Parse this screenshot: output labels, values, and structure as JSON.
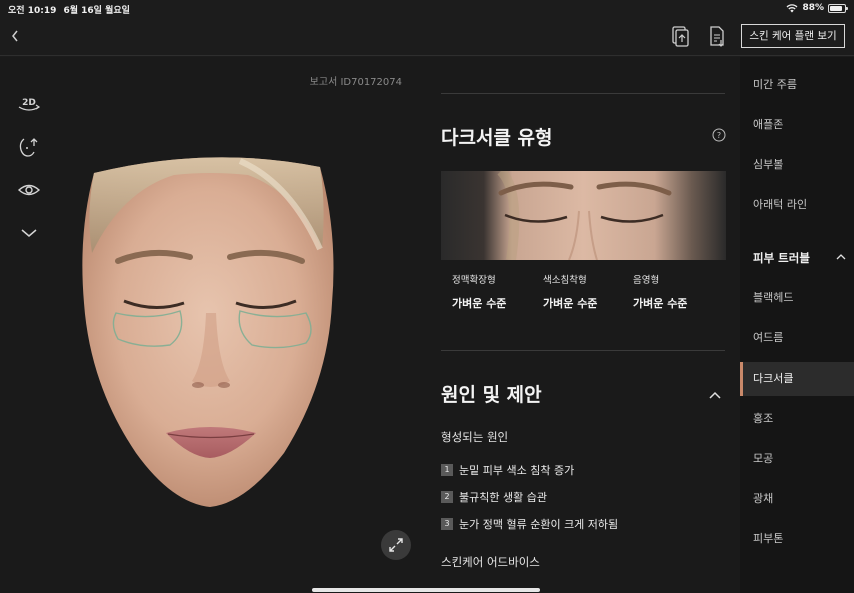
{
  "status_bar": {
    "time": "오전 10:19",
    "date": "6월 16일 월요일",
    "battery": "88%",
    "battery_level": 0.88,
    "wifi_icon": "wifi-icon",
    "battery_icon": "battery-icon"
  },
  "nav": {
    "back_icon": "chevron-left-icon",
    "share_icon": "document-share-icon",
    "export_icon": "document-export-icon",
    "plan_button": "스킨 케어 플랜 보기"
  },
  "left_panel": {
    "report_id": "보고서 ID70172074",
    "tools": {
      "view_2d_label": "2D",
      "view_2d_icon": "2d-rotate-icon",
      "rotate_icon": "face-rotate-icon",
      "eye_icon": "eye-icon",
      "more_icon": "chevron-down-icon"
    },
    "expand_icon": "expand-icon"
  },
  "content": {
    "cut_top_text": "-",
    "dark_circle_title": "다크서클 유형",
    "help_icon": "question-circle-icon",
    "types": [
      {
        "name": "정맥확장형",
        "level": "가벼운 수준"
      },
      {
        "name": "색소침착형",
        "level": "가벼운 수준"
      },
      {
        "name": "음영형",
        "level": "가벼운 수준"
      }
    ],
    "cause_title": "원인 및 제안",
    "collapse_icon": "chevron-up-icon",
    "forming_cause": "형성되는 원인",
    "causes": [
      {
        "num": "1",
        "text": "눈밑 피부 색소 침착 증가"
      },
      {
        "num": "2",
        "text": "불규칙한 생활 습관"
      },
      {
        "num": "3",
        "text": "눈가 정맥 혈류 순환이 크게 저하됨"
      }
    ],
    "advice_title": "스킨케어 어드바이스",
    "cut_bottom_text": "…"
  },
  "sidebar": {
    "items": [
      {
        "label": "미간 주름"
      },
      {
        "label": "애플존"
      },
      {
        "label": "심부볼"
      },
      {
        "label": "아래턱 라인"
      }
    ],
    "group_header": "피부 트러블",
    "group_chevron": "chevron-up-icon",
    "trouble_items": [
      {
        "label": "블랙헤드"
      },
      {
        "label": "여드름"
      },
      {
        "label": "다크서클",
        "active": true
      },
      {
        "label": "홍조"
      },
      {
        "label": "모공"
      },
      {
        "label": "광채"
      },
      {
        "label": "피부톤"
      }
    ],
    "accent_color": "#c9896a"
  }
}
